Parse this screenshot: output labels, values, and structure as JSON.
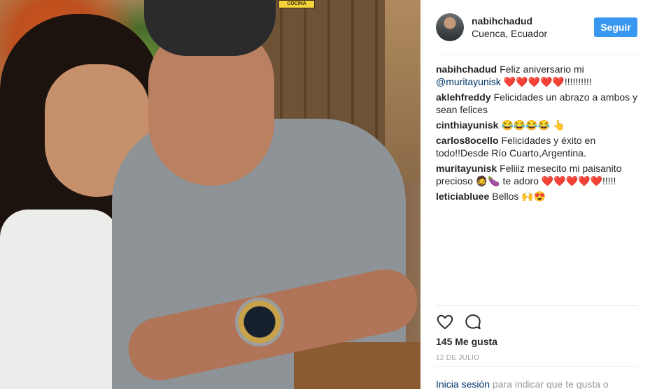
{
  "header": {
    "username": "nabihchadud",
    "location": "Cuenca, Ecuador",
    "follow_label": "Seguir"
  },
  "photo": {
    "sign_text": "COCINA"
  },
  "comments": [
    {
      "user": "nabihchadud",
      "pre": "Feliz aniversario mi ",
      "mention": "@muritayunisk",
      "post": " ❤️❤️❤️❤️❤️!!!!!!!!!!"
    },
    {
      "user": "aklehfreddy",
      "pre": "Felicidades un abrazo a ambos y sean felices",
      "mention": "",
      "post": ""
    },
    {
      "user": "cinthiayunisk",
      "pre": "😂😂😂😂 👆",
      "mention": "",
      "post": ""
    },
    {
      "user": "carlos8ocello",
      "pre": "Felicidades y éxito en todo!!Desde Río Cuarto,Argentina.",
      "mention": "",
      "post": ""
    },
    {
      "user": "muritayunisk",
      "pre": "Feliiiz mesecito mi paisanito precioso 🧔🍆 te adoro ❤️❤️❤️❤️❤️!!!!!",
      "mention": "",
      "post": ""
    },
    {
      "user": "leticiabluee",
      "pre": "Bellos 🙌😍",
      "mention": "",
      "post": ""
    }
  ],
  "actions": {
    "like_icon": "heart-outline-icon",
    "comment_icon": "comment-bubble-icon"
  },
  "likes_text": "145 Me gusta",
  "date_text": "12 DE JULIO",
  "login": {
    "link_text": "Inicia sesión",
    "rest_text": " para indicar que te gusta o"
  }
}
